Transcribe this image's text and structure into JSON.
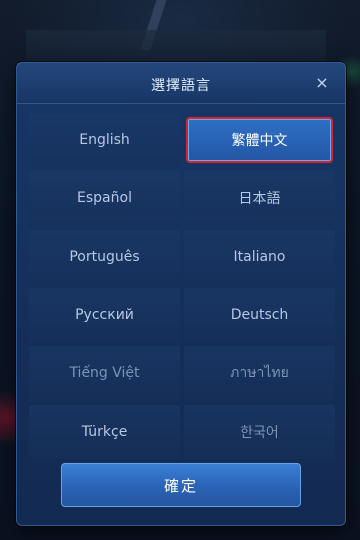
{
  "dialog": {
    "title": "選擇語言",
    "close_label": "×",
    "confirm_label": "確定"
  },
  "languages": [
    {
      "label": "English",
      "selected": false,
      "dim": false
    },
    {
      "label": "繁體中文",
      "selected": true,
      "dim": false
    },
    {
      "label": "Español",
      "selected": false,
      "dim": false
    },
    {
      "label": "日本語",
      "selected": false,
      "dim": false
    },
    {
      "label": "Português",
      "selected": false,
      "dim": false
    },
    {
      "label": "Italiano",
      "selected": false,
      "dim": false
    },
    {
      "label": "Русский",
      "selected": false,
      "dim": false
    },
    {
      "label": "Deutsch",
      "selected": false,
      "dim": false
    },
    {
      "label": "Tiếng Việt",
      "selected": false,
      "dim": true
    },
    {
      "label": "ภาษาไทย",
      "selected": false,
      "dim": true
    },
    {
      "label": "Türkçe",
      "selected": false,
      "dim": false
    },
    {
      "label": "한국어",
      "selected": false,
      "dim": true
    }
  ],
  "colors": {
    "selected_fill": "#2f6fc4",
    "highlight_outline": "#d9242e",
    "dialog_bg": "#163260"
  }
}
